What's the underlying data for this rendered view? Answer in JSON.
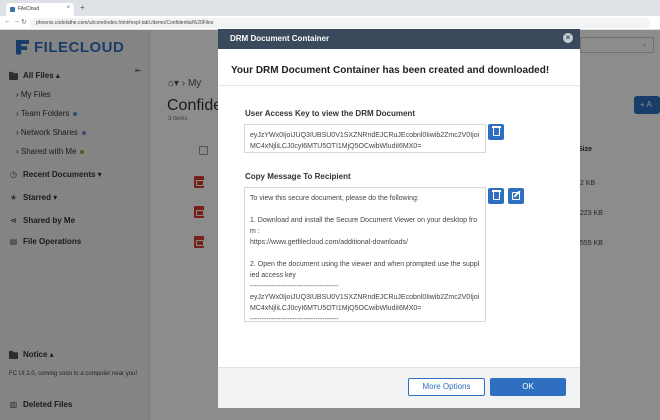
{
  "browser": {
    "tab_title": "FileCloud",
    "url": "phoenix.codelathe.com/ui/core/index.html#expl-tabl./demo/Confidential%20Files"
  },
  "app": {
    "logo_text": "FILECLOUD",
    "search_placeholder": "⌄",
    "breadcrumb": "My",
    "page_title": "Confider",
    "item_count": "3 items",
    "add_button_label": "+ A",
    "size_header": "Size",
    "file_sizes": [
      "2 KB",
      "223 KB",
      "555 KB"
    ]
  },
  "sidebar": {
    "all_files": "All Files ▴",
    "my_files": "My Files",
    "team_folders": "Team Folders",
    "network_shares": "Network Shares",
    "shared_with_me": "Shared with Me",
    "recent_documents": "Recent Documents ▾",
    "starred": "Starred ▾",
    "shared_by_me": "Shared by Me",
    "file_operations": "File Operations",
    "notice": "Notice ▴",
    "notice_text": "FC UI 2.0, coming soon to a computer near you!",
    "deleted_files": "Deleted Files"
  },
  "colors": {
    "accent": "#2f6fbf",
    "team_dot": "#4a90d9",
    "network_dot": "#8a7bd6",
    "shared_dot": "#7ab648"
  },
  "modal": {
    "title": "DRM Document Container",
    "close_label": "×",
    "heading": "Your DRM Document Container has been created and downloaded!",
    "access_key_label": "User Access Key to view the DRM Document",
    "access_key_value": "eyJzYWx0IjoiJUQ3IUBSU0V1SXZNRndEJCRuJEcobnl0Iiwib2Zmc2V0IjoiMC4xNjliLCJ0cyI6MTU5OTI1MjQ5OCwibWludiI6MX0=",
    "copy_message_label": "Copy Message To Recipient",
    "copy_message_value": "To view this secure document, please do the following:\n\n1. Download and install the Secure Document Viewer on your desktop from :\nhttps://www.getfilecloud.com/additional-downloads/\n\n2. Open the document using the viewer and when prompted use the supplied access key\n--------------------------------------\neyJzYWx0IjoiJUQ3IUBSU0V1SXZNRndEJCRuJEcobnl0Iiwib2Zmc2V0IjoiMC4xNjliLCJ0cyI6MTU5OTI1MjQ5OCwibWludiI6MX0=\n--------------------------------------",
    "more_options_label": "More Options",
    "ok_label": "OK"
  },
  "icons": {
    "delete": "trash-icon",
    "edit": "edit-icon",
    "home": "home-icon",
    "pdf": "pdf-icon"
  }
}
